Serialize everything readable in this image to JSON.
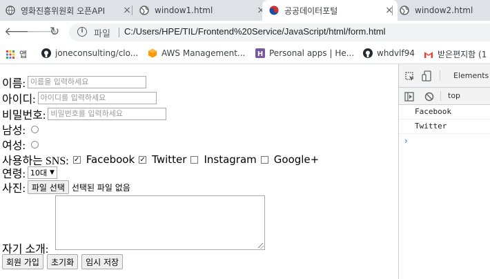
{
  "tabs": [
    {
      "title": "영화진흥위원회 오픈API",
      "close": "×"
    },
    {
      "title": "window1.html",
      "close": "×"
    },
    {
      "title": "공공데이터포털",
      "close": "×"
    },
    {
      "title": "window2.html",
      "close": ""
    }
  ],
  "address": {
    "scheme_label": "파일",
    "url": "C:/Users/HPE/TIL/Frontend%20Service/JavaScript/html/form.html"
  },
  "bookmarks": [
    {
      "label": "앱"
    },
    {
      "label": "joneconsulting/clo..."
    },
    {
      "label": "AWS Management..."
    },
    {
      "label": "Personal apps | He..."
    },
    {
      "label": "whdvlf94"
    },
    {
      "label": "받은편지함 (1"
    }
  ],
  "form": {
    "name_label": "이름:",
    "name_placeholder": "이름을 입력하세요",
    "id_label": "아이디:",
    "id_placeholder": "아이디를 입력하세요",
    "pw_label": "비밀번호:",
    "pw_placeholder": "비밀번호를 입력하세요",
    "male_label": "남성:",
    "female_label": "여성:",
    "sns_label": "사용하는 SNS:",
    "sns": [
      {
        "label": "Facebook",
        "checked": true
      },
      {
        "label": "Twitter",
        "checked": true
      },
      {
        "label": "Instagram",
        "checked": false
      },
      {
        "label": "Google+",
        "checked": false
      }
    ],
    "age_label": "연령:",
    "age_value": "10대",
    "photo_label": "사진:",
    "file_button": "파일 선택",
    "file_status": "선택된 파일 없음",
    "intro_label": "자기 소개:",
    "buttons": [
      "회원 가입",
      "초기화",
      "임시 저장"
    ]
  },
  "devtools": {
    "elements_tab": "Elements",
    "context": "top",
    "logs": [
      "Facebook",
      "Twitter"
    ],
    "prompt": "›"
  },
  "colors": {
    "tabbar": "#dee1e6",
    "accent": "#1a73e8"
  }
}
